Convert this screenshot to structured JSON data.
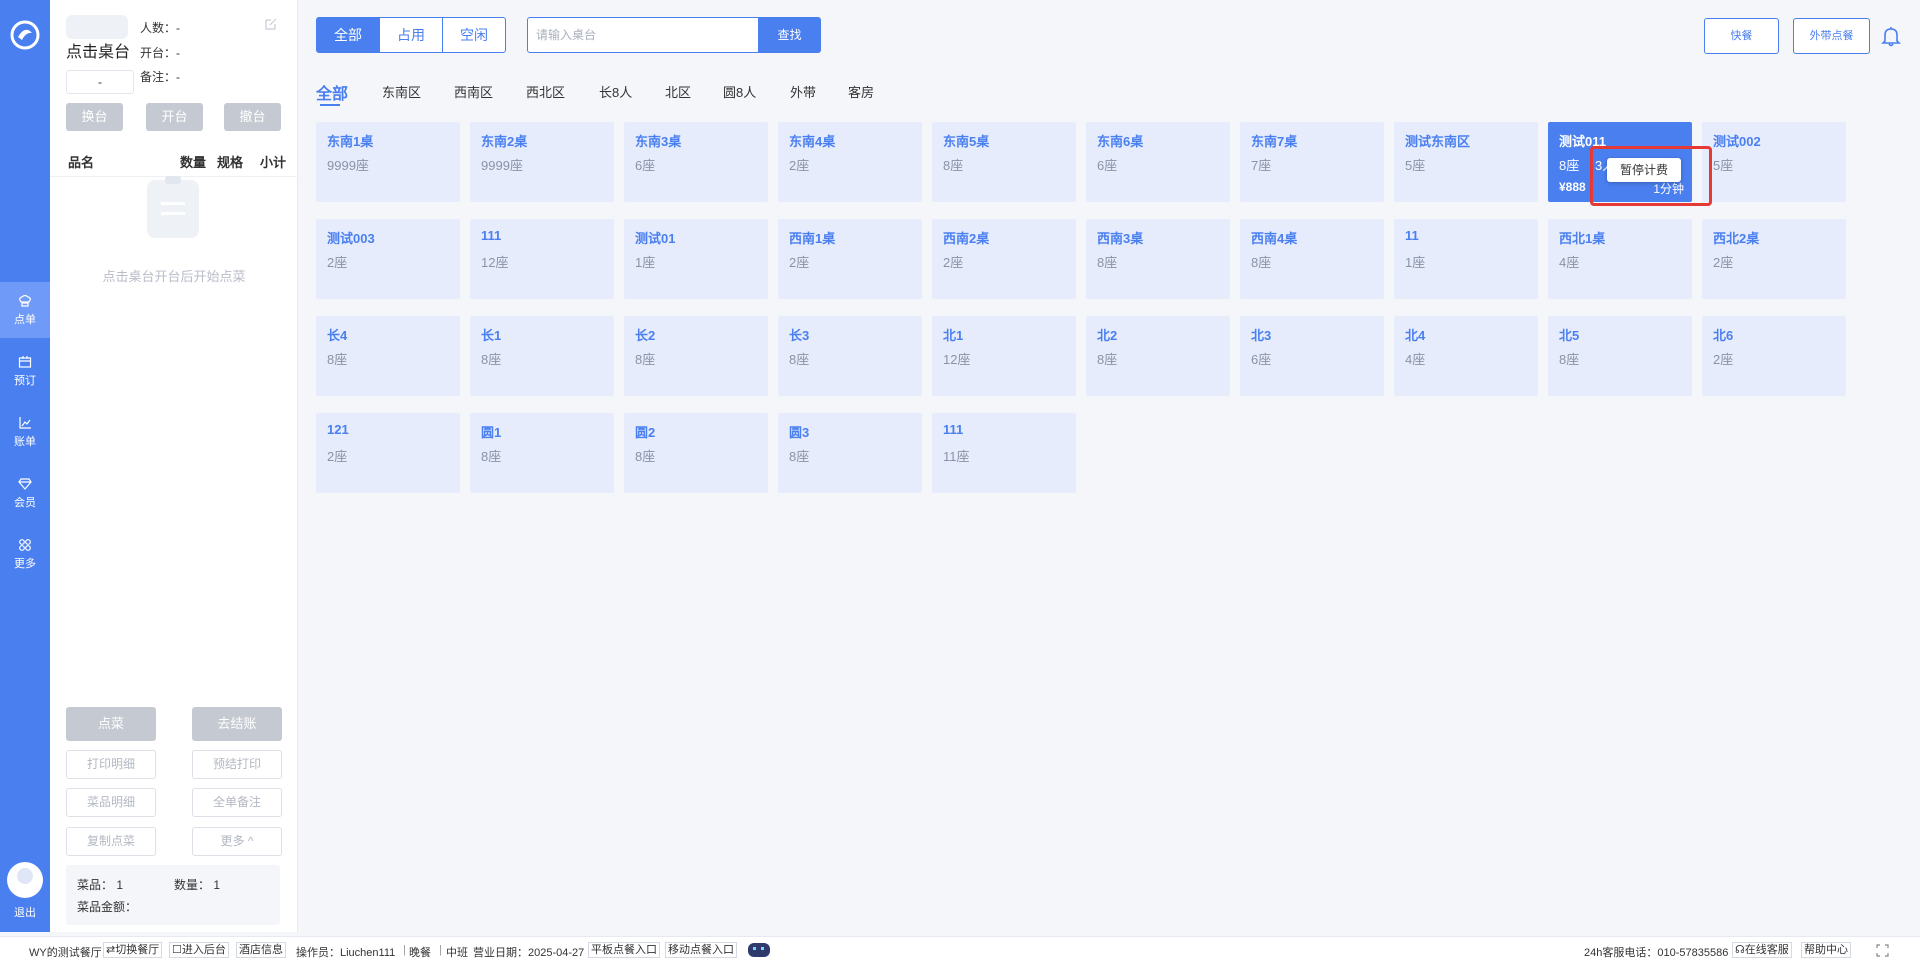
{
  "rail": {
    "items": [
      {
        "label": "点单",
        "icon": "chef-hat-icon"
      },
      {
        "label": "预订",
        "icon": "calendar-icon"
      },
      {
        "label": "账单",
        "icon": "chart-icon"
      },
      {
        "label": "会员",
        "icon": "diamond-icon"
      },
      {
        "label": "更多",
        "icon": "grid-icon"
      }
    ],
    "logout_label": "退出"
  },
  "order_panel": {
    "table_name": "点击桌台",
    "table_select_value": "-",
    "people": "人数：-",
    "opened": "开台：-",
    "note": "备注：-",
    "action_buttons": [
      "换台",
      "开台",
      "撤台"
    ],
    "list_headers": {
      "name": "品名",
      "qty": "数量",
      "spec": "规格",
      "subtotal": "小计"
    },
    "empty_text": "点击桌台开台后开始点菜",
    "order_button": "点菜",
    "checkout_button": "去结账",
    "secondary_buttons": [
      "打印明细",
      "预结打印",
      "菜品明细",
      "全单备注",
      "复制点菜",
      "更多 ^"
    ],
    "summary": {
      "dishes": "菜品：  1",
      "quantity": "数量：  1",
      "amount": "菜品金额："
    }
  },
  "filters": {
    "tabs": [
      "全部",
      "占用",
      "空闲"
    ],
    "active": 0
  },
  "search": {
    "placeholder": "请输入桌台",
    "button": "查找"
  },
  "top_buttons": {
    "fast_meal": "快餐",
    "takeout": "外带点餐"
  },
  "area_tabs": [
    "全部",
    "东南区",
    "西南区",
    "西北区",
    "长8人",
    "北区",
    "圆8人",
    "外带",
    "客房"
  ],
  "tables": [
    {
      "name": "东南1桌",
      "seats": "9999座"
    },
    {
      "name": "东南2桌",
      "seats": "9999座"
    },
    {
      "name": "东南3桌",
      "seats": "6座"
    },
    {
      "name": "东南4桌",
      "seats": "2座"
    },
    {
      "name": "东南5桌",
      "seats": "8座"
    },
    {
      "name": "东南6桌",
      "seats": "6座"
    },
    {
      "name": "东南7桌",
      "seats": "7座"
    },
    {
      "name": "测试东南区",
      "seats": "5座"
    },
    {
      "name": "测试011",
      "seats": "8座",
      "occupied": true,
      "guests": "3人",
      "price": "¥888",
      "time": "1分钟"
    },
    {
      "name": "测试002",
      "seats": "5座"
    },
    {
      "name": "测试003",
      "seats": "2座"
    },
    {
      "name": "111",
      "seats": "12座"
    },
    {
      "name": "测试01",
      "seats": "1座"
    },
    {
      "name": "西南1桌",
      "seats": "2座"
    },
    {
      "name": "西南2桌",
      "seats": "2座"
    },
    {
      "name": "西南3桌",
      "seats": "8座"
    },
    {
      "name": "西南4桌",
      "seats": "8座"
    },
    {
      "name": "11",
      "seats": "1座"
    },
    {
      "name": "西北1桌",
      "seats": "4座"
    },
    {
      "name": "西北2桌",
      "seats": "2座"
    },
    {
      "name": "长4",
      "seats": "8座"
    },
    {
      "name": "长1",
      "seats": "8座"
    },
    {
      "name": "长2",
      "seats": "8座"
    },
    {
      "name": "长3",
      "seats": "8座"
    },
    {
      "name": "北1",
      "seats": "12座"
    },
    {
      "name": "北2",
      "seats": "8座"
    },
    {
      "name": "北3",
      "seats": "6座"
    },
    {
      "name": "北4",
      "seats": "4座"
    },
    {
      "name": "北5",
      "seats": "8座"
    },
    {
      "name": "北6",
      "seats": "2座"
    },
    {
      "name": "121",
      "seats": "2座"
    },
    {
      "name": "圆1",
      "seats": "8座"
    },
    {
      "name": "圆2",
      "seats": "8座"
    },
    {
      "name": "圆3",
      "seats": "8座"
    },
    {
      "name": "111",
      "seats": "11座"
    }
  ],
  "popup": {
    "label": "暂停计费"
  },
  "status_bar": {
    "restaurant": "WY的测试餐厅",
    "switch": "⇄切换餐厅",
    "backend": "☐进入后台",
    "hotel_info": "酒店信息",
    "operator": "操作员：Liuchen111",
    "meal": "晚餐",
    "shift": "中班",
    "business_date": "营业日期：2025-04-27",
    "tablet_entry": "平板点餐入口",
    "mobile_entry": "移动点餐入口",
    "hotline": "24h客服电话：010-57835586",
    "online_service": "☊在线客服",
    "help_center": "帮助中心"
  }
}
